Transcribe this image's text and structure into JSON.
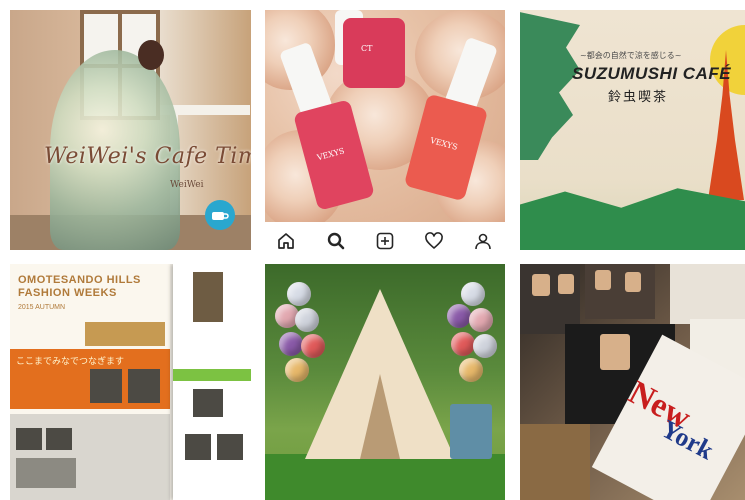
{
  "tile1": {
    "title": "WeiWei's Cafe Time",
    "subtitle": "WeiWei"
  },
  "tile2": {
    "bottle_label_1": "CT",
    "bottle_label_2": "VEXYS",
    "bottle_label_3": "VEXYS"
  },
  "instagram_bar": {
    "icons": [
      "home-icon",
      "search-icon",
      "add-post-icon",
      "heart-icon",
      "profile-icon"
    ]
  },
  "tile3": {
    "small_text": "~都会の自然で涼を感じる~",
    "title": "SUZUMUSHI CAFÉ",
    "japanese": "鈴虫喫茶"
  },
  "tile4": {
    "heading": "OMOTESANDO HILLS\nFASHION WEEKS",
    "date": "2015 AUTUMN",
    "orange_text": "ここまでみなでつなぎます"
  },
  "tile6": {
    "magazine_word_1": "New",
    "magazine_word_2": "York"
  },
  "colors": {
    "instagram_icon": "#262626",
    "tile3_title": "#222222",
    "tile4_orange": "#e36f1e",
    "tile6_red": "#c81e1e",
    "tile6_blue": "#1f3a8a"
  }
}
